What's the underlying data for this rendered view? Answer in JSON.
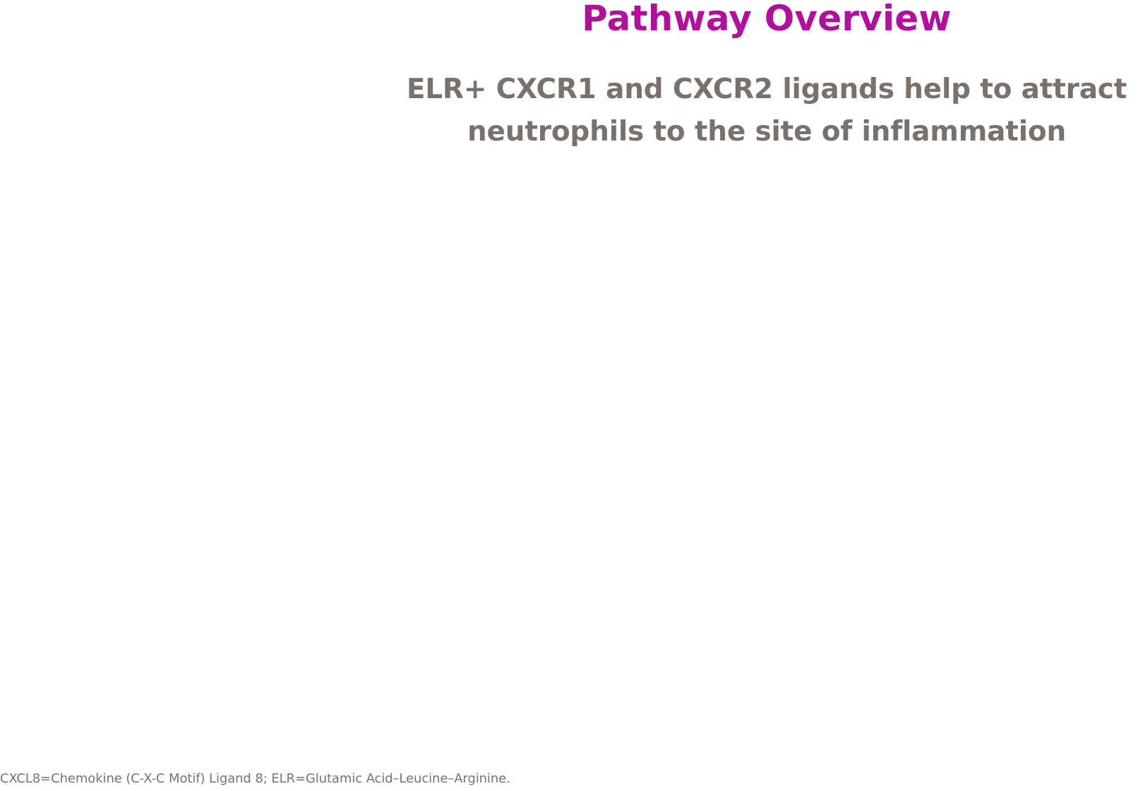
{
  "header": {
    "title": "Pathway Overview",
    "subtitle_lines": [
      "ELR+ CXCR1 and CXCR2 ligands help to attract",
      "neutrophils to the site of inflammation"
    ]
  },
  "footer": {
    "footnote": "CXCL8=Chemokine (C-X-C Motif) Ligand 8; ELR=Glutamic Acid–Leucine–Arginine."
  },
  "colors": {
    "title": "#b0109b",
    "text_gray": "#7b716b",
    "background": "#ffffff"
  }
}
